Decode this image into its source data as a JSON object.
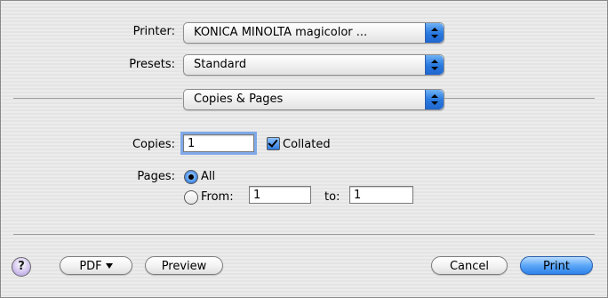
{
  "printer": {
    "label": "Printer:",
    "value": "KONICA MINOLTA magicolor ..."
  },
  "presets": {
    "label": "Presets:",
    "value": "Standard"
  },
  "section": {
    "value": "Copies & Pages"
  },
  "copies": {
    "label": "Copies:",
    "value": "1",
    "collated_label": "Collated",
    "collated": true
  },
  "pages": {
    "label": "Pages:",
    "all_label": "All",
    "from_label": "From:",
    "from_value": "1",
    "to_label": "to:",
    "to_value": "1",
    "selected": "All"
  },
  "buttons": {
    "help": "?",
    "pdf": "PDF",
    "preview": "Preview",
    "cancel": "Cancel",
    "print": "Print"
  },
  "colors": {
    "default_button": "#5ba7f7",
    "stepper": "#2b7be0"
  }
}
